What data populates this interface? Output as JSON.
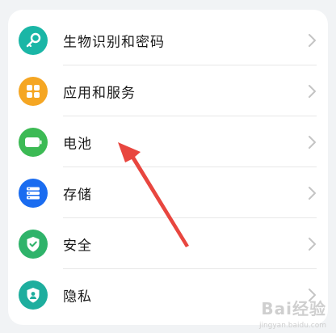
{
  "settings": {
    "items": [
      {
        "label": "生物识别和密码",
        "icon": "key-icon",
        "color": "#1ab6a6"
      },
      {
        "label": "应用和服务",
        "icon": "apps-grid-icon",
        "color": "#f5a623"
      },
      {
        "label": "电池",
        "icon": "battery-icon",
        "color": "#3cba54"
      },
      {
        "label": "存储",
        "icon": "storage-icon",
        "color": "#1a6cf0"
      },
      {
        "label": "安全",
        "icon": "shield-check-icon",
        "color": "#2fb36a"
      },
      {
        "label": "隐私",
        "icon": "privacy-shield-icon",
        "color": "#1eae9e"
      }
    ]
  },
  "annotation": {
    "color": "#e8463f"
  },
  "watermark": {
    "logo": "Bai经验",
    "sub": "jingyan.baidu.com"
  }
}
